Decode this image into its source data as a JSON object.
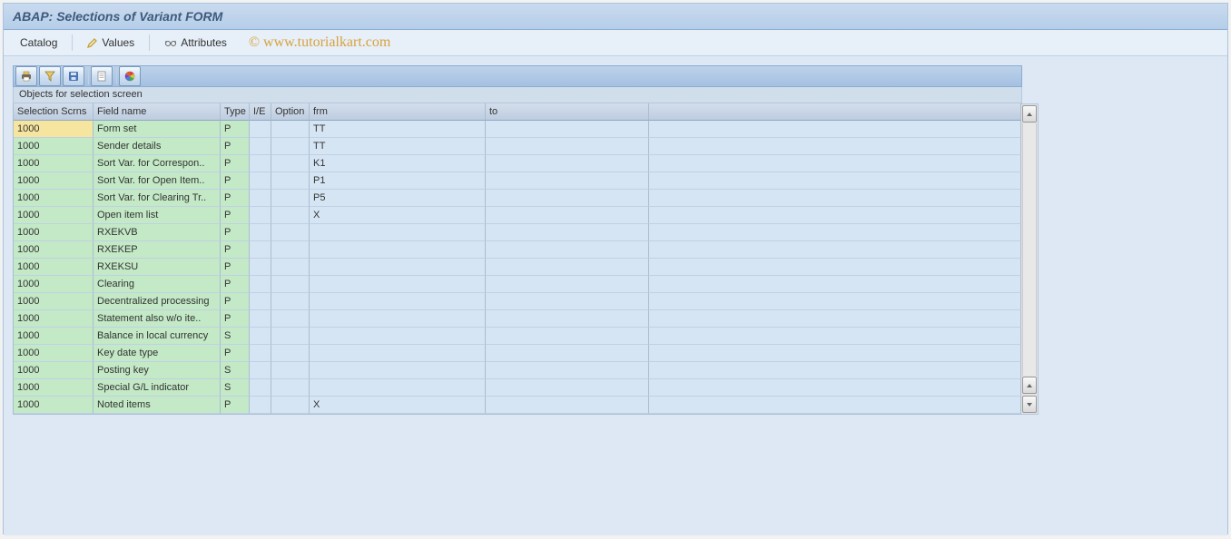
{
  "title": "ABAP: Selections of Variant FORM",
  "toolbar1": {
    "catalog": "Catalog",
    "values": "Values",
    "attributes": "Attributes"
  },
  "watermark": "© www.tutorialkart.com",
  "section_header": "Objects for selection screen",
  "columns": {
    "scrn": "Selection Scrns",
    "field": "Field name",
    "type": "Type",
    "ie": "I/E",
    "opt": "Option",
    "frm": "frm",
    "to": "to"
  },
  "rows": [
    {
      "scrn": "1000",
      "field": "Form set",
      "type": "P",
      "ie": "",
      "opt": "",
      "frm": "TT",
      "to": "",
      "sel": true
    },
    {
      "scrn": "1000",
      "field": "Sender details",
      "type": "P",
      "ie": "",
      "opt": "",
      "frm": "TT",
      "to": ""
    },
    {
      "scrn": "1000",
      "field": "Sort Var. for Correspon..",
      "type": "P",
      "ie": "",
      "opt": "",
      "frm": "K1",
      "to": ""
    },
    {
      "scrn": "1000",
      "field": "Sort Var. for Open Item..",
      "type": "P",
      "ie": "",
      "opt": "",
      "frm": "P1",
      "to": ""
    },
    {
      "scrn": "1000",
      "field": "Sort Var. for Clearing Tr..",
      "type": "P",
      "ie": "",
      "opt": "",
      "frm": "P5",
      "to": ""
    },
    {
      "scrn": "1000",
      "field": "Open item list",
      "type": "P",
      "ie": "",
      "opt": "",
      "frm": "X",
      "to": ""
    },
    {
      "scrn": "1000",
      "field": "RXEKVB",
      "type": "P",
      "ie": "",
      "opt": "",
      "frm": "",
      "to": ""
    },
    {
      "scrn": "1000",
      "field": "RXEKEP",
      "type": "P",
      "ie": "",
      "opt": "",
      "frm": "",
      "to": ""
    },
    {
      "scrn": "1000",
      "field": "RXEKSU",
      "type": "P",
      "ie": "",
      "opt": "",
      "frm": "",
      "to": ""
    },
    {
      "scrn": "1000",
      "field": "Clearing",
      "type": "P",
      "ie": "",
      "opt": "",
      "frm": "",
      "to": ""
    },
    {
      "scrn": "1000",
      "field": "Decentralized processing",
      "type": "P",
      "ie": "",
      "opt": "",
      "frm": "",
      "to": ""
    },
    {
      "scrn": "1000",
      "field": "Statement also w/o ite..",
      "type": "P",
      "ie": "",
      "opt": "",
      "frm": "",
      "to": ""
    },
    {
      "scrn": "1000",
      "field": "Balance in local currency",
      "type": "S",
      "ie": "",
      "opt": "",
      "frm": "",
      "to": ""
    },
    {
      "scrn": "1000",
      "field": "Key date type",
      "type": "P",
      "ie": "",
      "opt": "",
      "frm": "",
      "to": ""
    },
    {
      "scrn": "1000",
      "field": "Posting key",
      "type": "S",
      "ie": "",
      "opt": "",
      "frm": "",
      "to": ""
    },
    {
      "scrn": "1000",
      "field": "Special G/L indicator",
      "type": "S",
      "ie": "",
      "opt": "",
      "frm": "",
      "to": ""
    },
    {
      "scrn": "1000",
      "field": "Noted items",
      "type": "P",
      "ie": "",
      "opt": "",
      "frm": "X",
      "to": ""
    }
  ]
}
